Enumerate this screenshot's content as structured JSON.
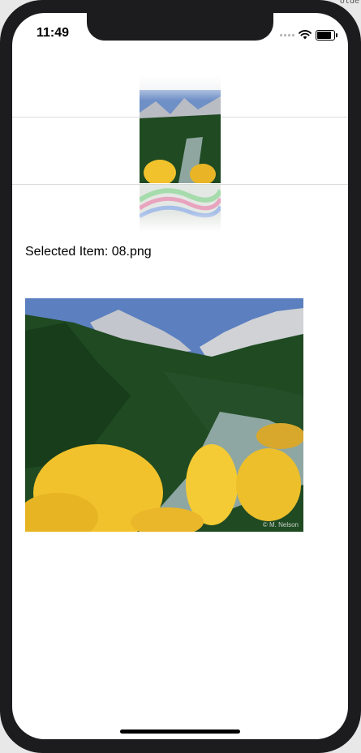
{
  "background": {
    "corner_text": "olde"
  },
  "status_bar": {
    "time": "11:49",
    "icons": [
      "cellular-signal-icon",
      "wifi-icon",
      "battery-icon"
    ]
  },
  "picker": {
    "items": [
      "07.png",
      "08.png",
      "09.png"
    ],
    "selected": "08.png"
  },
  "selection": {
    "label": "Selected Item: 08.png"
  },
  "main_image": {
    "watermark": "© M. Nelson"
  },
  "colors": {
    "frame": "#1c1c1e",
    "screen": "#ffffff",
    "sky": "#5b7fbf",
    "aspen_yellow": "#f2c22c",
    "forest_green": "#1f4a22"
  }
}
